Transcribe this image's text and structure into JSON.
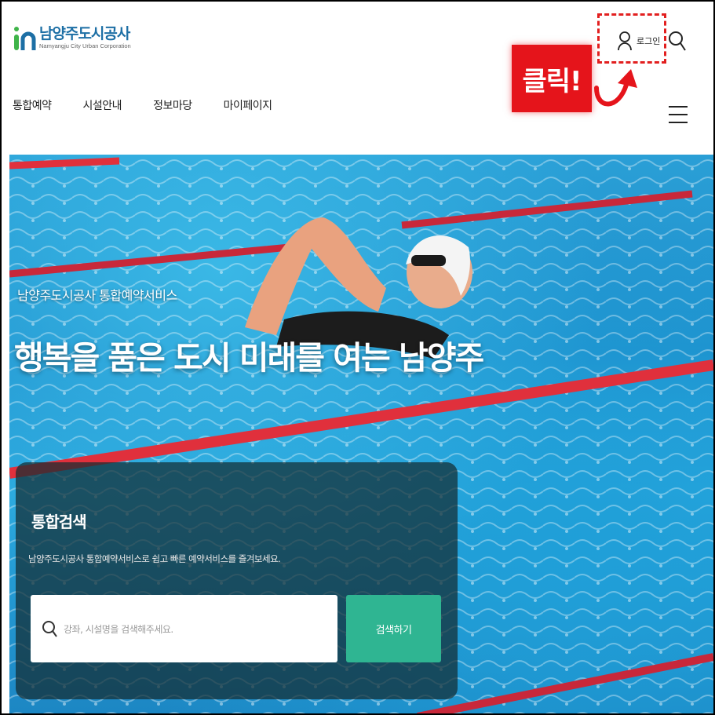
{
  "header": {
    "logo_name": "남양주도시공사",
    "logo_sub": "Namyangju City Urban Corporation",
    "login_label": "로그인",
    "annotation_click": "클릭!"
  },
  "nav": {
    "items": [
      "통합예약",
      "시설안내",
      "정보마당",
      "마이페이지"
    ]
  },
  "hero": {
    "subtitle": "남양주도시공사 통합예약서비스",
    "title": "행복을 품은 도시 미래를 여는 남양주"
  },
  "search": {
    "title": "통합검색",
    "description": "남양주도시공사 통합예약서비스로 쉽고 빠른 예약서비스를 즐겨보세요.",
    "placeholder": "강좌, 시설명을 검색해주세요.",
    "button_label": "검색하기"
  },
  "colors": {
    "annotation_red": "#e5141b",
    "search_button": "#2fb592",
    "logo_blue": "#1d6fa5",
    "logo_green": "#3fb449"
  }
}
